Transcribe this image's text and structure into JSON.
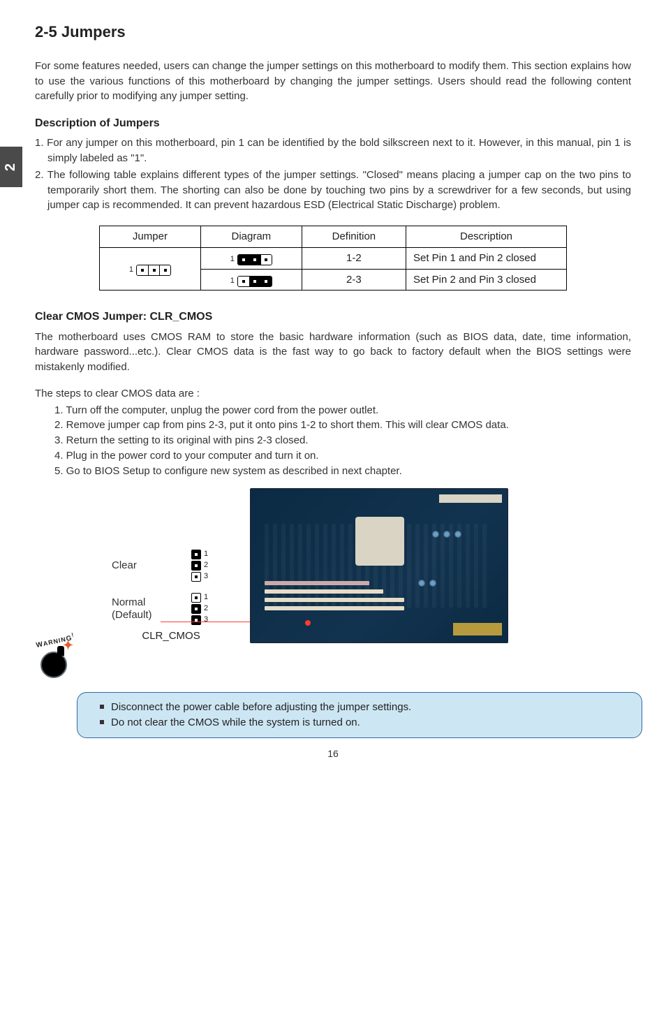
{
  "section_tab": "2",
  "title": "2-5 Jumpers",
  "intro": "For some features needed, users can change the jumper settings on this motherboard to modify them. This section explains how to use the various functions of this motherboard by changing the jumper settings. Users should read the following content carefully prior to modifying any jumper setting.",
  "desc_heading": "Description of Jumpers",
  "desc_items": [
    "1. For any jumper on this motherboard, pin 1 can be identified by the bold silkscreen next to it. However, in this manual, pin 1 is simply labeled as \"1\".",
    "2. The following table explains different types of the jumper settings. \"Closed\" means placing a jumper cap on the two pins to temporarily short them. The shorting can also be done by touching two pins by a screwdriver for a few seconds, but using jumper cap is recommended. It can prevent hazardous ESD (Electrical Static Discharge) problem."
  ],
  "table": {
    "headers": [
      "Jumper",
      "Diagram",
      "Definition",
      "Description"
    ],
    "rows": [
      {
        "definition": "1-2",
        "description": "Set Pin 1 and Pin 2 closed"
      },
      {
        "definition": "2-3",
        "description": "Set Pin 2 and Pin 3 closed"
      }
    ]
  },
  "cmos_heading": "Clear CMOS Jumper: CLR_CMOS",
  "cmos_para": "The motherboard uses CMOS RAM to store the basic hardware information (such as BIOS data, date, time information, hardware password...etc.). Clear CMOS data is the fast way to go back to factory default when the BIOS settings were mistakenly modified.",
  "steps_intro": "The steps to clear CMOS data are :",
  "steps": [
    "1. Turn off the computer, unplug the power cord from the power outlet.",
    "2. Remove jumper cap from pins 2-3, put it onto pins 1-2 to short them. This will clear CMOS data.",
    "3. Return the setting to its original with pins 2-3 closed.",
    "4. Plug in the power cord to your computer and turn it on.",
    "5. Go to BIOS Setup to configure new system as described in next chapter."
  ],
  "cmos_labels": {
    "clear": "Clear",
    "normal_line1": "Normal",
    "normal_line2": "(Default)",
    "caption": "CLR_CMOS",
    "pin_numbers": [
      "1",
      "2",
      "3"
    ]
  },
  "warning_label": "WARNING!",
  "callout": [
    "Disconnect the power cable before adjusting the jumper settings.",
    "Do not clear the CMOS while the system is turned on."
  ],
  "page_number": "16",
  "icons": {
    "section_tab": "section-tab",
    "jumper_row": "jumper-diagram",
    "bullet": "square-bullet",
    "bomb": "bomb-icon"
  }
}
